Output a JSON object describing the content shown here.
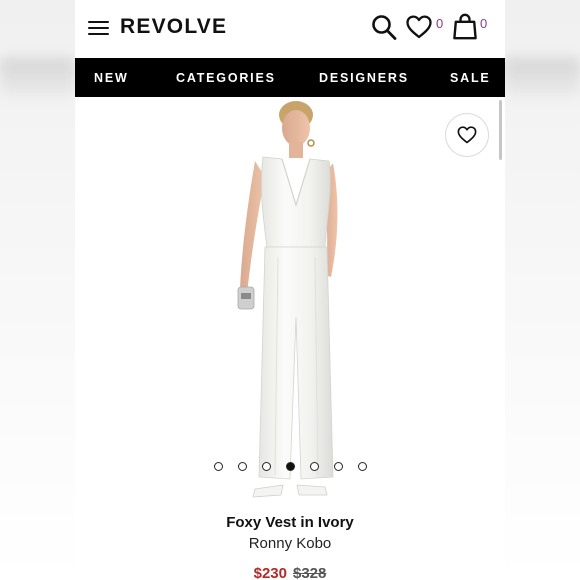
{
  "header": {
    "logo": "REVOLVE",
    "wishlist_count": "0",
    "bag_count": "0"
  },
  "nav": {
    "items": [
      "NEW",
      "CATEGORIES",
      "DESIGNERS",
      "SALE"
    ]
  },
  "carousel": {
    "total_images": 7,
    "active_index": 3
  },
  "product": {
    "name": "Foxy Vest in Ivory",
    "brand": "Ronny Kobo",
    "price_sale": "$230",
    "price_original": "$328"
  },
  "colors": {
    "nav_background": "#000000",
    "sale_price": "#b52a26",
    "badge_count": "#8c3b8a"
  },
  "icons": {
    "menu": "hamburger-icon",
    "search": "search-icon",
    "wishlist": "heart-icon",
    "bag": "shopping-bag-icon",
    "favorite": "heart-icon"
  }
}
